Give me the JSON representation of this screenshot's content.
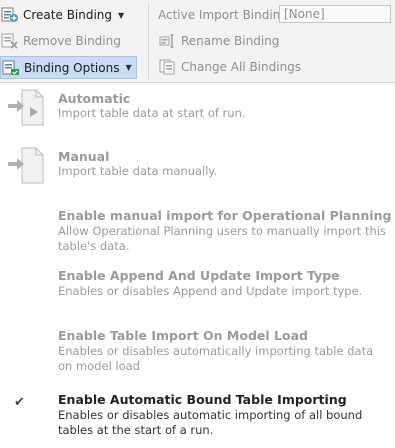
{
  "ribbon": {
    "create_binding": "Create Binding",
    "remove_binding": "Remove Binding",
    "binding_options": "Binding Options",
    "active_import_binding_label": "Active Import Binding",
    "active_import_binding_value": "[None]",
    "rename_binding": "Rename Binding",
    "change_all_bindings": "Change All Bindings",
    "icons": {
      "create_binding": "create-binding-icon",
      "remove_binding": "remove-binding-icon",
      "binding_options": "binding-options-icon",
      "rename_binding": "rename-icon",
      "change_all_bindings": "change-all-bindings-icon"
    }
  },
  "menu": {
    "items": [
      {
        "title": "Automatic",
        "description": "Import table data at start of run.",
        "enabled": false,
        "icon": "automatic-import-icon"
      },
      {
        "title": "Manual",
        "description": "Import table data manually.",
        "enabled": false,
        "icon": "manual-import-icon"
      },
      {
        "title": "Enable manual import for Operational Planning",
        "description": "Allow Operational Planning users to manually import this table's data.",
        "enabled": false
      },
      {
        "title": "Enable Append And Update Import Type",
        "description": "Enables or disables Append and Update import type.",
        "enabled": false
      },
      {
        "title": "Enable Table Import On Model Load",
        "description": "Enables or disables automatically importing table data on model load",
        "enabled": false
      },
      {
        "title": "Enable Automatic Bound Table Importing",
        "description": "Enables or disables automatic importing of all bound tables at the start of a run.",
        "enabled": true,
        "checked": true
      }
    ]
  },
  "colors": {
    "ribbon_bg": "#f3f3f3",
    "pressed_bg": "#c9dcf2",
    "disabled_text": "#9a9a9a",
    "enabled_text": "#222222"
  }
}
